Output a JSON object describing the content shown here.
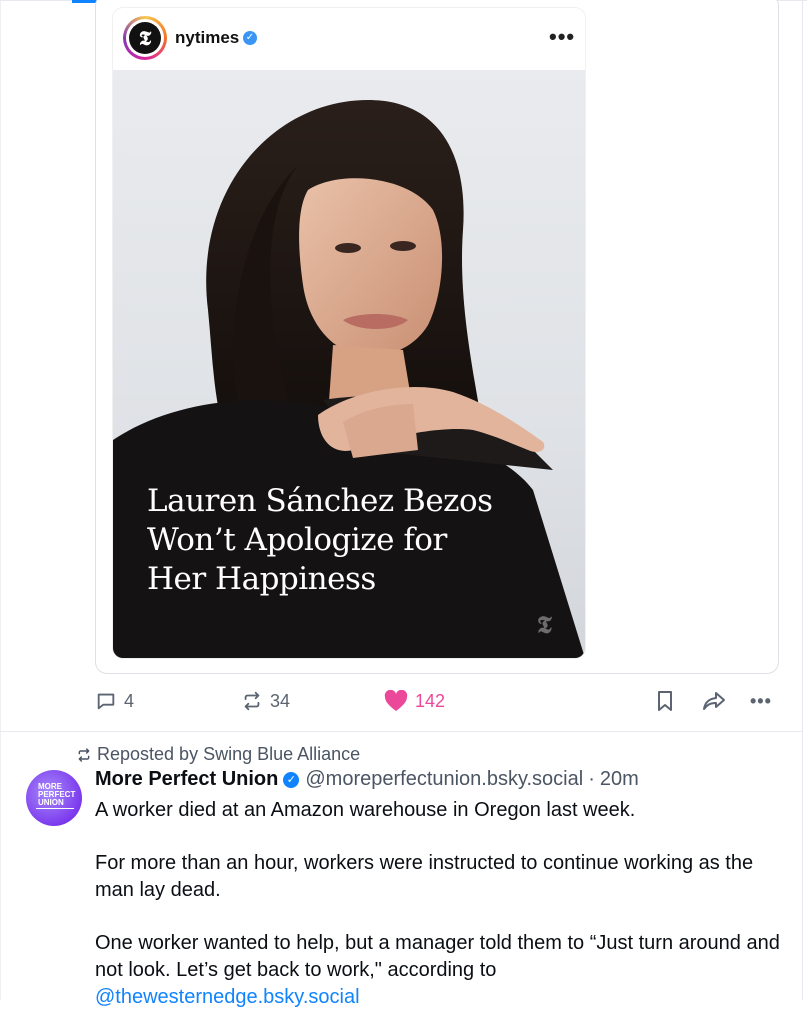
{
  "embed": {
    "account": "nytimes",
    "avatar_letter": "𝕿",
    "more_label": "•••",
    "headline_lines": [
      "Lauren Sánchez Bezos",
      "Won’t Apologize for",
      "Her Happiness"
    ],
    "watermark": "𝕿"
  },
  "actions": {
    "replies": "4",
    "reposts": "34",
    "likes": "142",
    "more_label": "•••"
  },
  "post2": {
    "repost_label": "Reposted by Swing Blue Alliance",
    "avatar_text": [
      "MORE",
      "PERFECT",
      "UNION"
    ],
    "author_name": "More Perfect Union",
    "handle": "@moreperfectunion.bsky.social",
    "sep": "·",
    "time": "20m",
    "paragraphs": [
      "A worker died at an Amazon warehouse in Oregon last week.",
      "For more than an hour, workers were instructed to continue working as the man lay dead.",
      "One worker wanted to help, but a manager told them to “Just turn around and not look. Let’s get back to work,\" according to"
    ],
    "link": "@thewesternedge.bsky.social"
  },
  "colors": {
    "accent": "#1083fe",
    "like": "#ec4899",
    "muted": "#5b6470"
  }
}
